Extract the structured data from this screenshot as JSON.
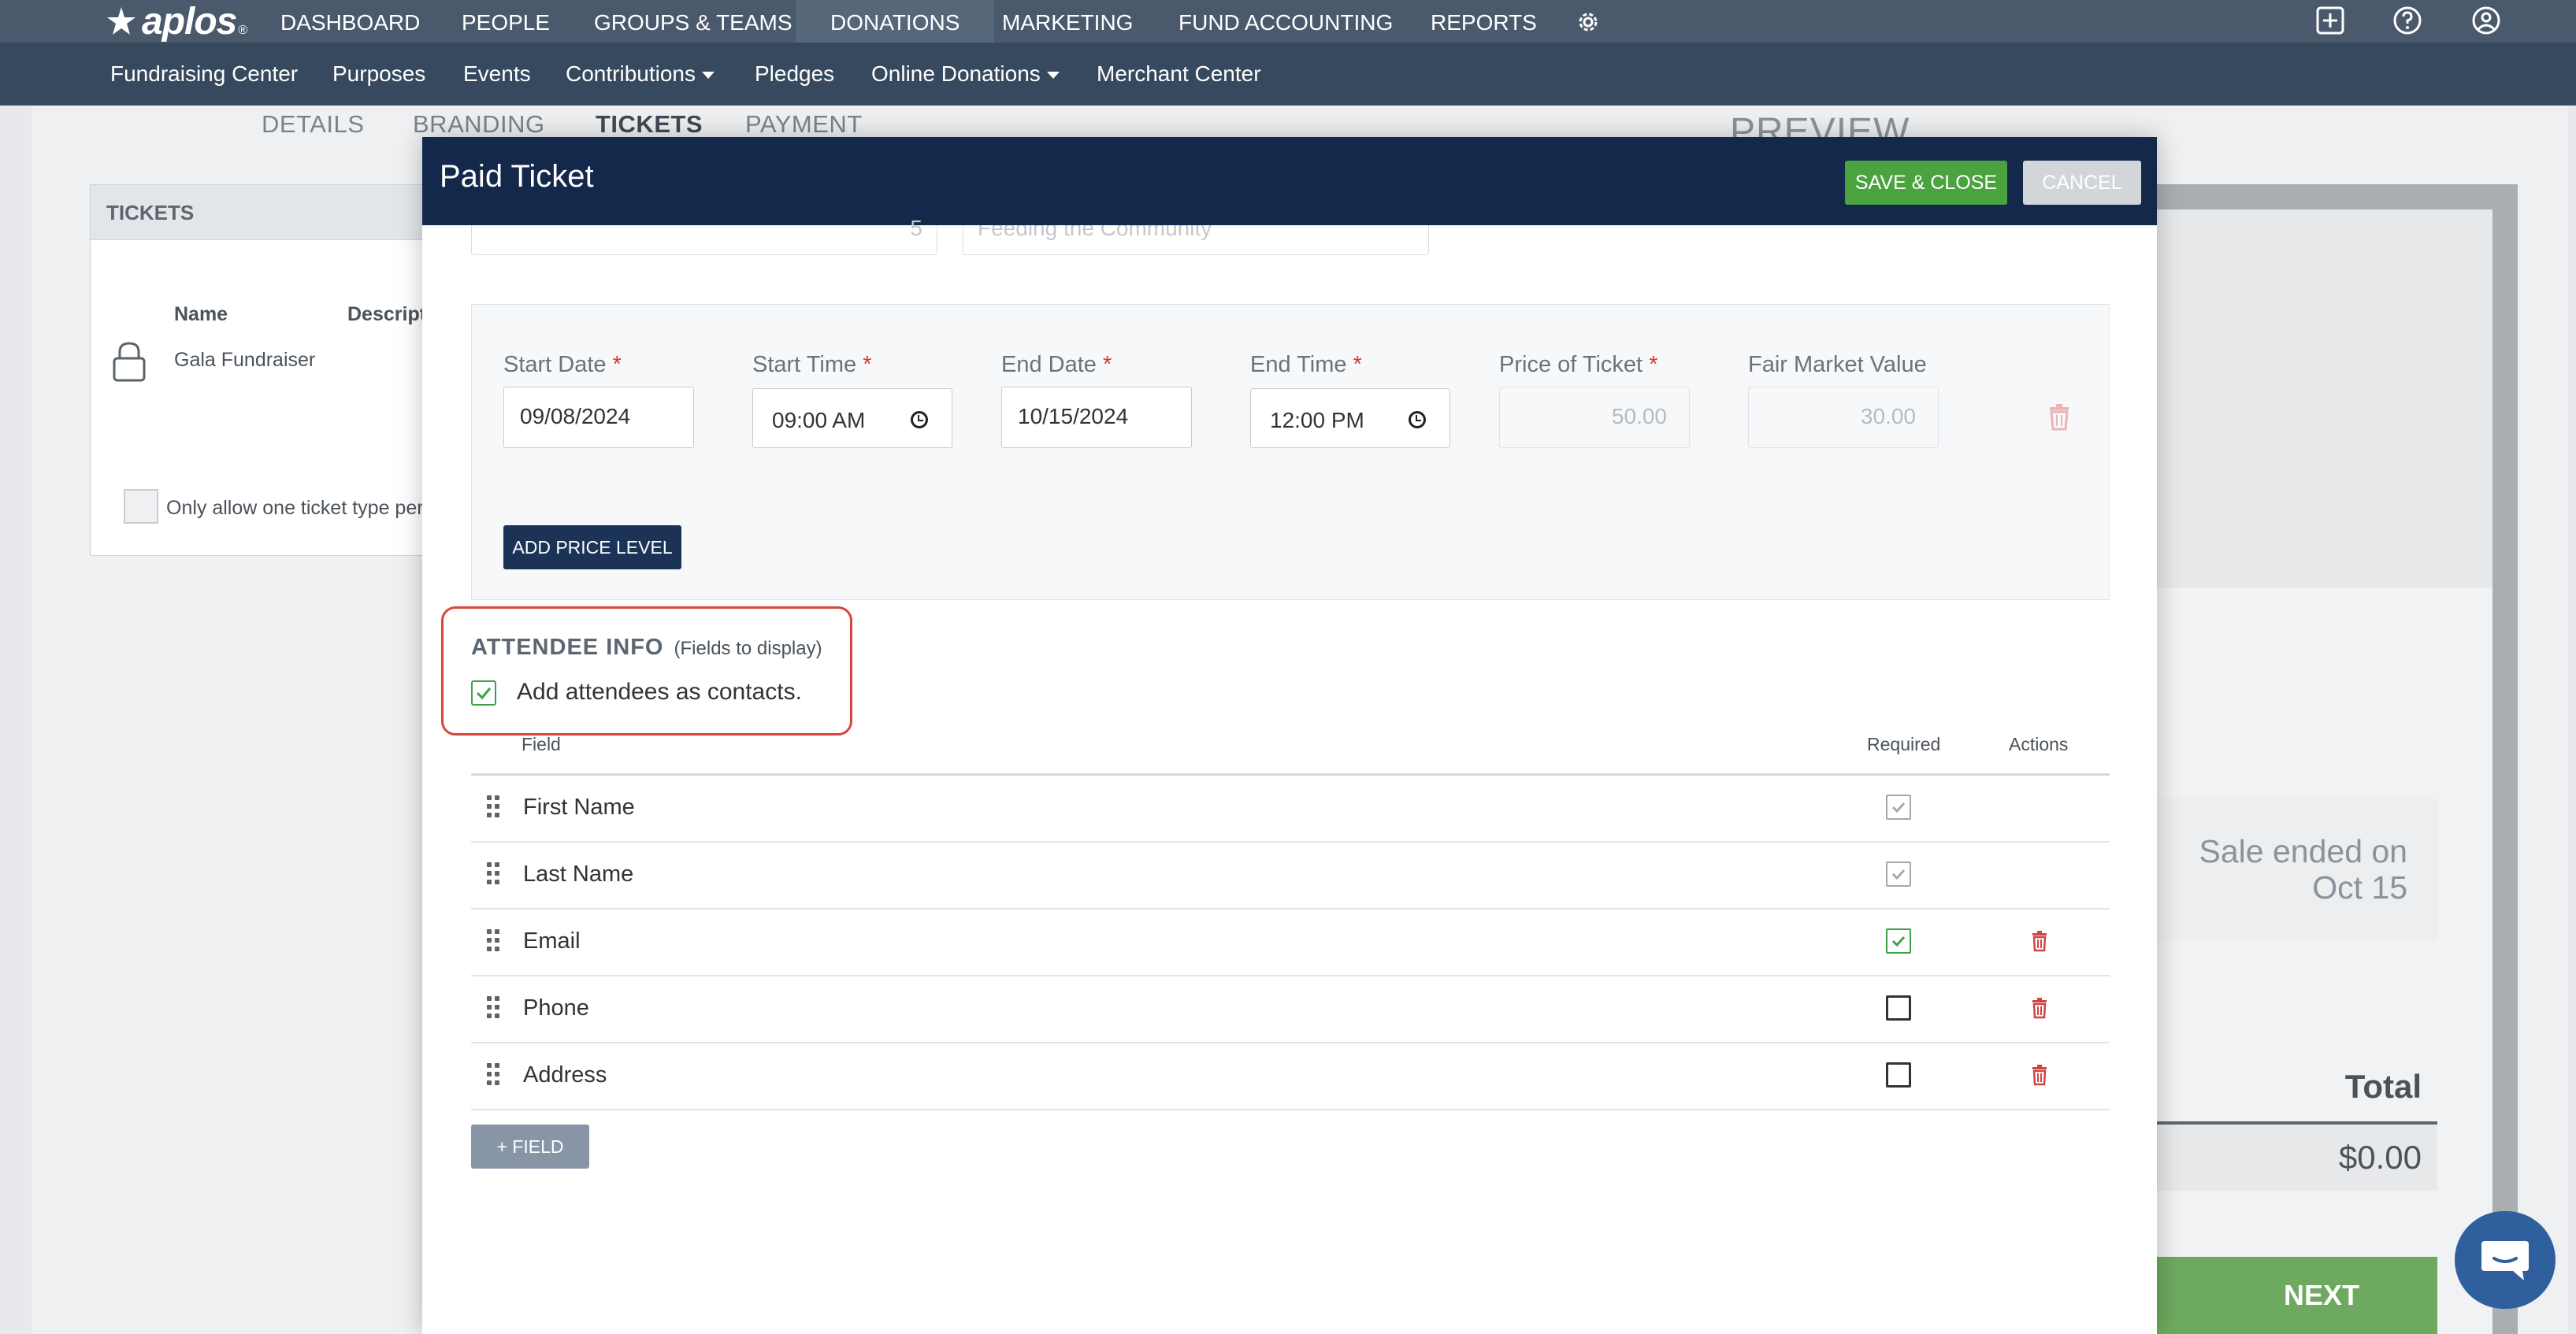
{
  "app": {
    "logo_text": "aplos",
    "logo_reg": "®"
  },
  "topnav": {
    "items": [
      {
        "label": "DASHBOARD"
      },
      {
        "label": "PEOPLE"
      },
      {
        "label": "GROUPS & TEAMS"
      },
      {
        "label": "DONATIONS",
        "active": true
      },
      {
        "label": "MARKETING"
      },
      {
        "label": "FUND ACCOUNTING"
      },
      {
        "label": "REPORTS"
      }
    ],
    "icons": [
      "gear-icon",
      "add-icon",
      "help-icon",
      "user-icon"
    ]
  },
  "subnav": {
    "items": [
      {
        "label": "Fundraising Center"
      },
      {
        "label": "Purposes"
      },
      {
        "label": "Events"
      },
      {
        "label": "Contributions",
        "dropdown": true
      },
      {
        "label": "Pledges"
      },
      {
        "label": "Online Donations",
        "dropdown": true
      },
      {
        "label": "Merchant Center"
      }
    ]
  },
  "background": {
    "tabs": [
      "DETAILS",
      "BRANDING",
      "TICKETS",
      "PAYMENT"
    ],
    "active_tab": "TICKETS",
    "tickets_card": {
      "title": "TICKETS",
      "col_name": "Name",
      "col_description": "Descript",
      "ticket_name": "Gala Fundraiser",
      "checkbox_label": "Only allow one ticket type per"
    },
    "preview": {
      "title": "PREVIEW",
      "sale_ended_line1": "Sale ended on",
      "sale_ended_line2": "Oct 15",
      "total_label": "Total",
      "total_value": "$0.00",
      "next_label": "NEXT"
    }
  },
  "modal": {
    "title": "Paid Ticket",
    "save_label": "SAVE & CLOSE",
    "cancel_label": "CANCEL",
    "prev_fields": {
      "quantity_partial": "5",
      "purpose_partial": "Feeding the Community"
    },
    "price_level": {
      "start_date_label": "Start Date",
      "start_date": "09/08/2024",
      "start_time_label": "Start Time",
      "start_time": "09:00 AM",
      "end_date_label": "End Date",
      "end_date": "10/15/2024",
      "end_time_label": "End Time",
      "end_time": "12:00 PM",
      "price_label": "Price of Ticket",
      "price": "50.00",
      "fmv_label": "Fair Market Value",
      "fmv": "30.00",
      "required_marker": "*",
      "add_button": "ADD PRICE LEVEL"
    },
    "attendee": {
      "title": "ATTENDEE INFO",
      "subtitle": "(Fields to display)",
      "add_contacts_label": "Add attendees as contacts.",
      "add_contacts_checked": true,
      "highlight_color": "#d8463c"
    },
    "fields_table": {
      "headers": {
        "field": "Field",
        "required": "Required",
        "actions": "Actions"
      },
      "rows": [
        {
          "label": "First Name",
          "required": "locked-checked",
          "deletable": false
        },
        {
          "label": "Last Name",
          "required": "locked-checked",
          "deletable": false
        },
        {
          "label": "Email",
          "required": "checked",
          "deletable": true
        },
        {
          "label": "Phone",
          "required": "unchecked",
          "deletable": true
        },
        {
          "label": "Address",
          "required": "unchecked",
          "deletable": true
        }
      ],
      "add_field_label": "+ FIELD"
    }
  },
  "colors": {
    "topnav": "#4a5a6c",
    "subnav": "#37495e",
    "modal_header": "#13284b",
    "save_green": "#4aa33f",
    "check_green": "#3aa34b",
    "trash_red": "#d04444",
    "required_red": "#d33a3a"
  }
}
